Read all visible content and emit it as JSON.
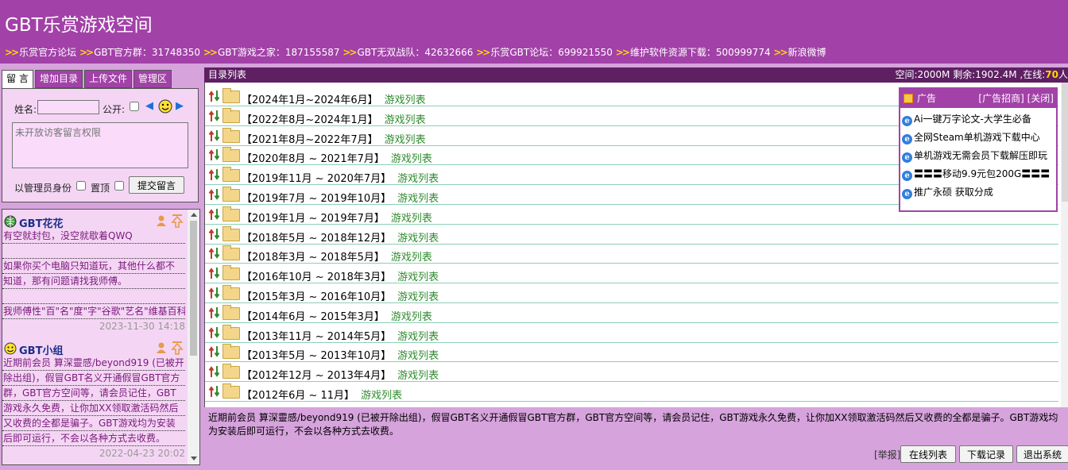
{
  "site_title": "GBT乐赏游戏空间",
  "links": [
    "乐赏官方论坛",
    "GBT官方群：31748350",
    "GBT游戏之家：187155587",
    "GBT无双战队：42632666",
    "乐赏GBT论坛：699921550",
    "维护软件资源下载：500999774",
    "新浪微博"
  ],
  "tabs": [
    "留 言",
    "增加目录",
    "上传文件",
    "管理区"
  ],
  "form": {
    "name_label": "姓名:",
    "public_label": "公开:",
    "message_placeholder": "未开放访客留言权限",
    "admin_label": "以管理员身份",
    "top_label": "置顶",
    "submit_label": "提交留言"
  },
  "messages": [
    {
      "user": "GBT花花",
      "lines": [
        "有空就封包，没空就歇着QWQ",
        "",
        "如果你买个电脑只知道玩，其他什么都不",
        "知道，那有问题请找我师傅。",
        "",
        "我师傅性\"百\"名\"度\"字\"谷歌\"艺名\"维基百科\""
      ],
      "time": "2023-11-30 14:18"
    },
    {
      "user": "GBT小组",
      "lines": [
        "近期前会员 算深靈感/beyond919 (已被开",
        "除出组)，假冒GBT名义开通假冒GBT官方",
        "群，GBT官方空间等，请会员记住，GBT",
        "游戏永久免费，让你加XX领取激活码然后",
        "又收费的全都是骗子。GBT游戏均为安装",
        "后即可运行，不会以各种方式去收费。"
      ],
      "time": "2022-04-23 20:02"
    }
  ],
  "directory": {
    "title": "目录列表",
    "stats_prefix": "空间:2000M 剩余:1902.4M ,在线:",
    "online": "70",
    "stats_suffix": "人",
    "link_label": "游戏列表",
    "rows": [
      "【2024年1月~2024年6月】",
      "【2022年8月~2024年1月】",
      "【2021年8月~2022年7月】",
      "【2020年8月 ~ 2021年7月】",
      "【2019年11月 ~ 2020年7月】",
      "【2019年7月 ~ 2019年10月】",
      "【2019年1月 ~ 2019年7月】",
      "【2018年5月 ~ 2018年12月】",
      "【2018年3月 ~ 2018年5月】",
      "【2016年10月 ~ 2018年3月】",
      "【2015年3月 ~ 2016年10月】",
      "【2014年6月 ~ 2015年3月】",
      "【2013年11月 ~ 2014年5月】",
      "【2013年5月 ~ 2013年10月】",
      "【2012年12月 ~ 2013年4月】",
      "【2012年6月 ~ 11月】"
    ]
  },
  "ad": {
    "title": "广告",
    "recruit": "[广告招商]",
    "close": "[关闭]",
    "items": [
      "Ai一键万字论文-大学生必备",
      "全网Steam单机游戏下载中心",
      "单机游戏无需会员下载解压即玩",
      "〓〓〓移动9.9元包200G〓〓〓",
      "推广永硕 获取分成"
    ]
  },
  "notice": "近期前会员 算深靈感/beyond919 (已被开除出组)，假冒GBT名义开通假冒GBT官方群，GBT官方空间等，请会员记住，GBT游戏永久免费，让你加XX领取激活码然后又收费的全都是骗子。GBT游戏均为安装后即可运行，不会以各种方式去收费。",
  "bottom": {
    "report": "[举报]",
    "online_list": "在线列表",
    "download_log": "下载记录",
    "logout": "退出系统"
  },
  "colors": {
    "header": "#a241a8",
    "page": "#d6a3dc",
    "dir_header": "#5e1f63",
    "accent_link": "#ffd700",
    "game_link": "#2e8b2e"
  }
}
